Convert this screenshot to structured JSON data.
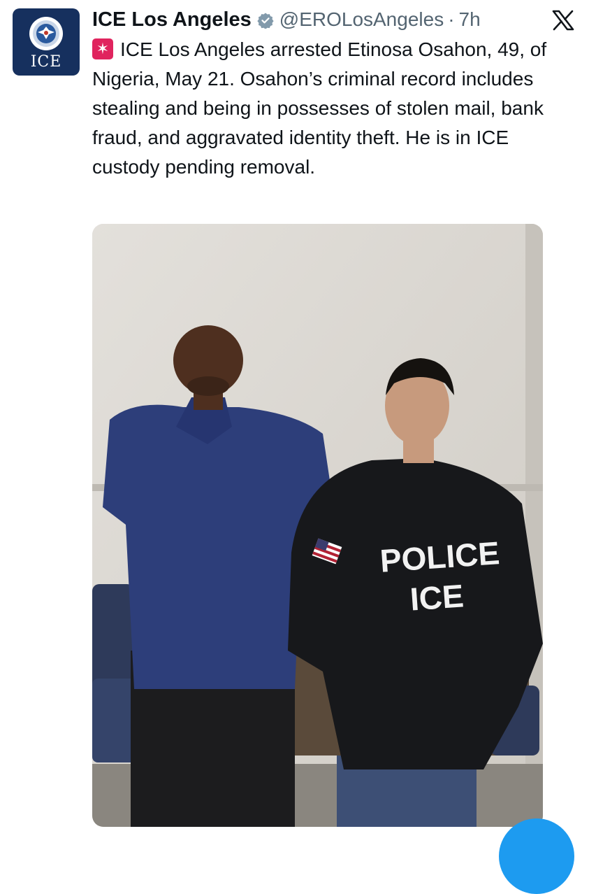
{
  "account": {
    "name": "ICE Los Angeles",
    "handle": "@EROLosAngeles",
    "separator": "·",
    "time": "7h",
    "avatar_text": "ICE",
    "verified_icon": "verified-badge-icon",
    "accent_color": "#1d9bf0",
    "avatar_color": "#16305e"
  },
  "tweet": {
    "icon": "rotating-light-icon",
    "text": "ICE Los Angeles arrested Etinosa Osahon, 49, of Nigeria, May 21. Osahon’s criminal record includes stealing and being in possesses of stolen mail, bank fraud, and aggravated identity theft. He is in ICE custody pending removal."
  },
  "media": {
    "jacket_line1": "POLICE",
    "jacket_line2": "ICE"
  }
}
